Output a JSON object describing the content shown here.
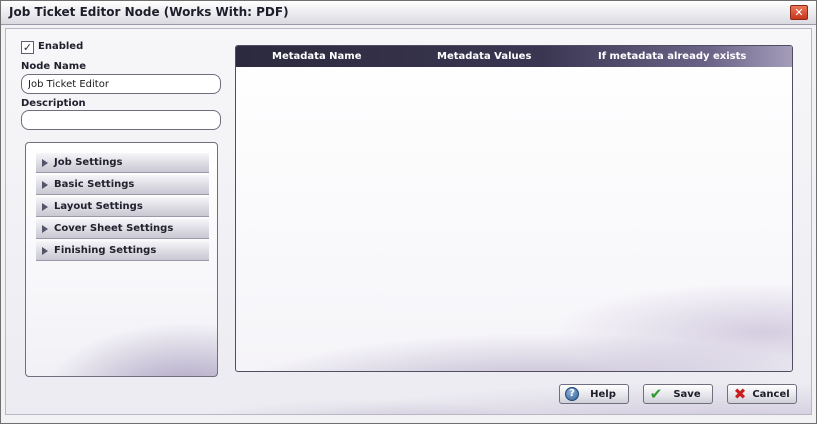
{
  "window": {
    "title": "Job Ticket Editor Node (Works With: PDF)",
    "close_glyph": "✕"
  },
  "form": {
    "enabled_label": "Enabled",
    "enabled_checked": true,
    "node_name_label": "Node Name",
    "node_name_value": "Job Ticket Editor",
    "description_label": "Description",
    "description_value": ""
  },
  "settings": {
    "items": [
      {
        "label": "Job Settings"
      },
      {
        "label": "Basic Settings"
      },
      {
        "label": "Layout Settings"
      },
      {
        "label": "Cover Sheet Settings"
      },
      {
        "label": "Finishing Settings"
      }
    ]
  },
  "metadata_table": {
    "columns": [
      "Metadata Name",
      "Metadata Values",
      "If metadata already exists"
    ],
    "rows": []
  },
  "buttons": {
    "help_label": "Help",
    "save_label": "Save",
    "cancel_label": "Cancel"
  },
  "icons": {
    "close": "close-icon",
    "checkbox": "checkmark-icon",
    "expand": "triangle-right-icon",
    "help": "question-circle-icon",
    "save": "checkmark-icon",
    "cancel": "x-icon"
  },
  "colors": {
    "header_dark": "#2c2a3e",
    "accent_purple": "#6b5a96",
    "close_red": "#c8361b"
  }
}
